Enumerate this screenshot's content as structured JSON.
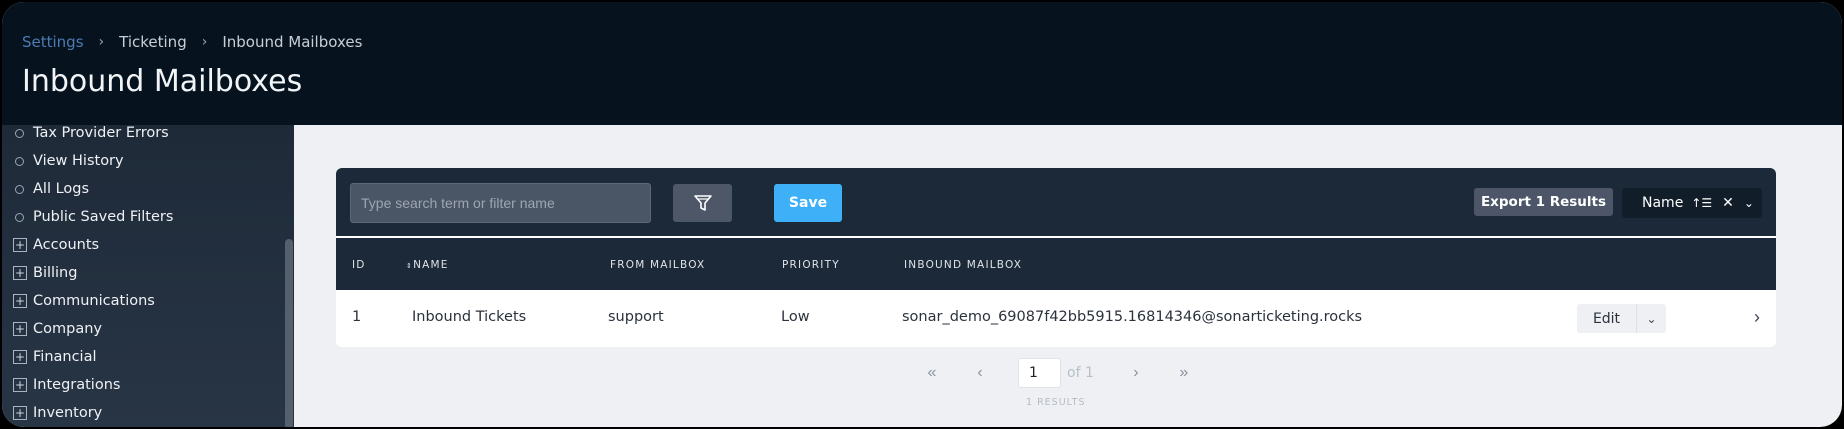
{
  "breadcrumb": {
    "item1": "Settings",
    "item2": "Ticketing",
    "item3": "Inbound Mailboxes"
  },
  "page_title": "Inbound Mailboxes",
  "sidebar": {
    "items": [
      {
        "label": "Tax Provider Errors",
        "icon": "circle-icon"
      },
      {
        "label": "View History",
        "icon": "circle-icon"
      },
      {
        "label": "All Logs",
        "icon": "circle-icon"
      },
      {
        "label": "Public Saved Filters",
        "icon": "circle-icon"
      },
      {
        "label": "Accounts",
        "icon": "plus-box-icon"
      },
      {
        "label": "Billing",
        "icon": "plus-box-icon"
      },
      {
        "label": "Communications",
        "icon": "plus-box-icon"
      },
      {
        "label": "Company",
        "icon": "plus-box-icon"
      },
      {
        "label": "Financial",
        "icon": "plus-box-icon"
      },
      {
        "label": "Integrations",
        "icon": "plus-box-icon"
      },
      {
        "label": "Inventory",
        "icon": "plus-box-icon"
      }
    ]
  },
  "toolbar": {
    "search_placeholder": "Type search term or filter name",
    "save_label": "Save",
    "export_label": "Export 1 Results",
    "sort_label": "Name"
  },
  "table": {
    "headers": {
      "id": "ID",
      "name": "NAME",
      "from_mailbox": "FROM MAILBOX",
      "priority": "PRIORITY",
      "inbound_mailbox": "INBOUND MAILBOX"
    },
    "rows": [
      {
        "id": "1",
        "name": "Inbound Tickets",
        "from_mailbox": "support",
        "priority": "Low",
        "inbound_mailbox": "sonar_demo_69087f42bb5915.16814346@sonarticketing.rocks",
        "edit_label": "Edit"
      }
    ]
  },
  "pagination": {
    "first": "«",
    "prev": "‹",
    "next": "›",
    "last": "»",
    "page_value": "1",
    "of_text": "of 1",
    "results_text": "1 RESULTS"
  },
  "colors": {
    "header_bg": "#06131f",
    "accent": "#3eb0f7",
    "toolbar_bg": "#1b2938"
  }
}
